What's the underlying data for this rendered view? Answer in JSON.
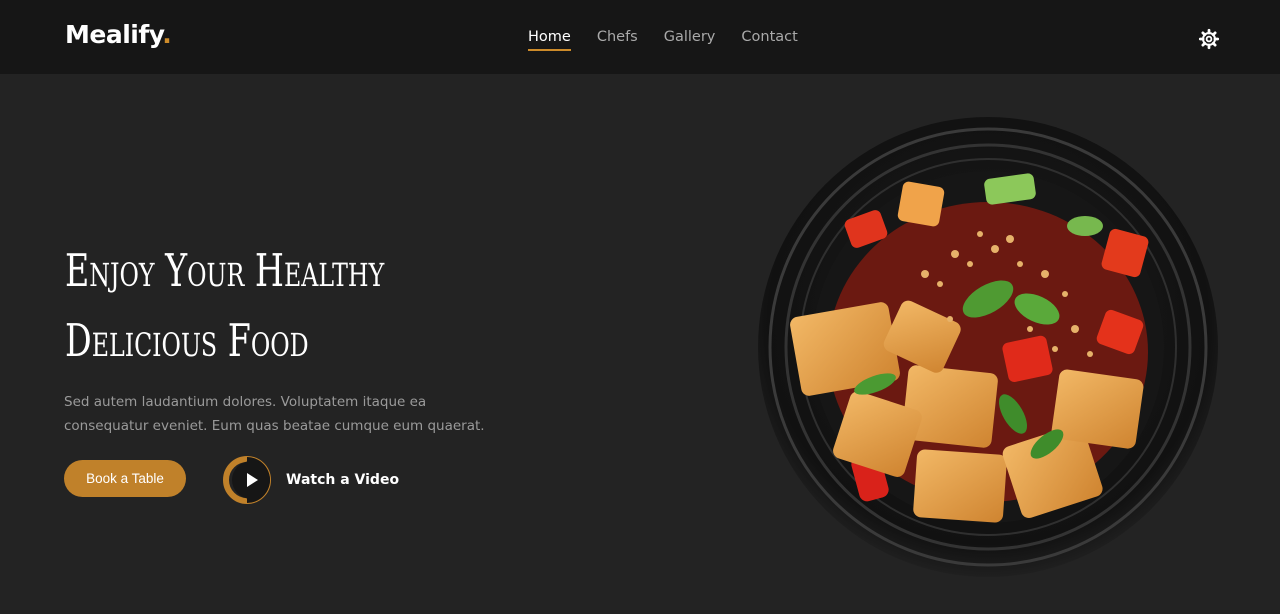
{
  "header": {
    "logo": {
      "text": "Mealify",
      "dot": "."
    },
    "nav": [
      {
        "label": "Home",
        "active": true
      },
      {
        "label": "Chefs",
        "active": false
      },
      {
        "label": "Gallery",
        "active": false
      },
      {
        "label": "Contact",
        "active": false
      }
    ],
    "settings_icon": "gear-icon"
  },
  "hero": {
    "title_line1": "Enjoy Your Healthy",
    "title_line2": "Delicious Food",
    "description": "Sed autem laudantium dolores. Voluptatem itaque ea consequatur eveniet. Eum quas beatae cumque eum quaerat.",
    "book_label": "Book a Table",
    "watch_label": "Watch a Video",
    "play_icon": "play-icon",
    "image": "food-plate-image"
  },
  "colors": {
    "accent": "#cd8b2a",
    "header_bg": "#161616",
    "page_bg": "#232323",
    "muted_text": "#9a9a9a"
  }
}
